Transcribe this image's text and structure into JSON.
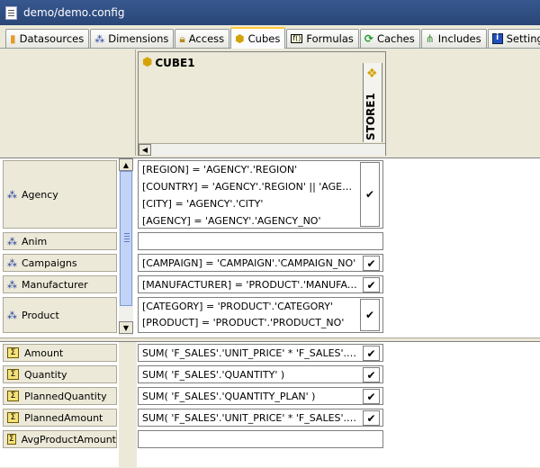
{
  "window": {
    "title": "demo/demo.config"
  },
  "tabs": [
    {
      "label": "Datasources",
      "icon": "database-icon",
      "active": false
    },
    {
      "label": "Dimensions",
      "icon": "dimension-icon",
      "active": false
    },
    {
      "label": "Access",
      "icon": "lock-icon",
      "active": false
    },
    {
      "label": "Cubes",
      "icon": "cube-icon",
      "active": true
    },
    {
      "label": "Formulas",
      "icon": "formula-icon",
      "active": false
    },
    {
      "label": "Caches",
      "icon": "cache-icon",
      "active": false
    },
    {
      "label": "Includes",
      "icon": "includes-icon",
      "active": false
    },
    {
      "label": "Settings",
      "icon": "info-icon",
      "active": false
    }
  ],
  "cube": {
    "name": "CUBE1",
    "store": "STORE1"
  },
  "dimensions": [
    {
      "name": "Agency",
      "lines": [
        "[REGION] = 'AGENCY'.'REGION'",
        "[COUNTRY] = 'AGENCY'.'REGION' || 'AGENCY'.'...",
        "[CITY] = 'AGENCY'.'CITY'",
        "[AGENCY] = 'AGENCY'.'AGENCY_NO'"
      ],
      "checked": true
    },
    {
      "name": "Anim",
      "lines": [],
      "checked": false
    },
    {
      "name": "Campaigns",
      "lines": [
        "[CAMPAIGN] = 'CAMPAIGN'.'CAMPAIGN_NO'"
      ],
      "checked": true
    },
    {
      "name": "Manufacturer",
      "lines": [
        "[MANUFACTURER] = 'PRODUCT'.'MANUFACTU..."
      ],
      "checked": true
    },
    {
      "name": "Product",
      "lines": [
        "[CATEGORY] = 'PRODUCT'.'CATEGORY'",
        "[PRODUCT] = 'PRODUCT'.'PRODUCT_NO'"
      ],
      "checked": true
    }
  ],
  "measures": [
    {
      "name": "Amount",
      "formula": "SUM( 'F_SALES'.'UNIT_PRICE' * 'F_SALES'.'QUA...",
      "checked": true
    },
    {
      "name": "Quantity",
      "formula": "SUM( 'F_SALES'.'QUANTITY' )",
      "checked": true
    },
    {
      "name": "PlannedQuantity",
      "formula": "SUM( 'F_SALES'.'QUANTITY_PLAN' )",
      "checked": true
    },
    {
      "name": "PlannedAmount",
      "formula": "SUM( 'F_SALES'.'UNIT_PRICE' * 'F_SALES'.'QUA...",
      "checked": true
    },
    {
      "name": "AvgProductAmount",
      "formula": "",
      "checked": false
    }
  ],
  "check_mark": "✔"
}
